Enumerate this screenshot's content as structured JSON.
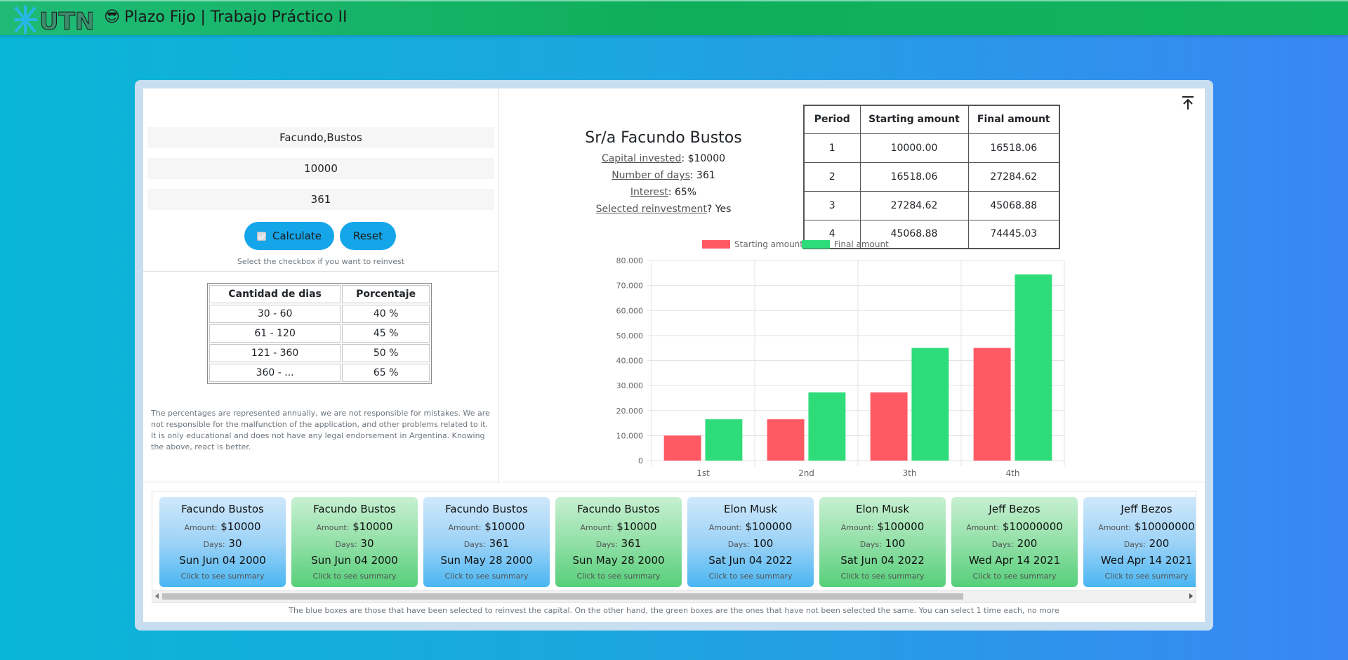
{
  "navbar": {
    "logo_text": "UTN",
    "title": "Plazo Fijo | Trabajo Práctico II",
    "title_emoji": "😎",
    "bg_color": "#12b35e"
  },
  "form": {
    "name_value": "Facundo,Bustos",
    "amount_value": "10000",
    "days_value": "361",
    "calculate_label": "Calculate",
    "reset_label": "Reset",
    "reinvest_checked": true,
    "hint": "Select the checkbox if you want to reinvest",
    "button_color": "#15a6ea"
  },
  "rates": {
    "headers": [
      "Cantidad de dias",
      "Porcentaje"
    ],
    "rows": [
      [
        "30 - 60",
        "40 %"
      ],
      [
        "61 - 120",
        "45 %"
      ],
      [
        "121 - 360",
        "50 %"
      ],
      [
        "360 - ...",
        "65 %"
      ]
    ]
  },
  "disclaimer": "The percentages are represented annually, we are not responsible for mistakes. We are not responsible for the malfunction of the application, and other problems related to it. It is only educational and does not have any legal endorsement in Argentina. Knowing the above, react is better.",
  "summary": {
    "title": "Sr/a Facundo Bustos",
    "capital_label": "Capital invested",
    "capital_value": ": $10000",
    "days_label": "Number of days",
    "days_value": ": 361",
    "interest_label": "Interest",
    "interest_value": ": 65%",
    "reinvest_label": "Selected reinvestment",
    "reinvest_value": "? Yes"
  },
  "periods": {
    "headers": [
      "Period",
      "Starting amount",
      "Final amount"
    ],
    "rows": [
      [
        "1",
        "10000.00",
        "16518.06"
      ],
      [
        "2",
        "16518.06",
        "27284.62"
      ],
      [
        "3",
        "27284.62",
        "45068.88"
      ],
      [
        "4",
        "45068.88",
        "74445.03"
      ]
    ]
  },
  "chart_data": {
    "type": "bar",
    "categories": [
      "1st",
      "2nd",
      "3th",
      "4th"
    ],
    "series": [
      {
        "name": "Starting amount",
        "values": [
          10000.0,
          16518.06,
          27284.62,
          45068.88
        ],
        "color": "#ff5a64"
      },
      {
        "name": "Final amount",
        "values": [
          16518.06,
          27284.62,
          45068.88,
          74445.03
        ],
        "color": "#2fdc7a"
      }
    ],
    "ylim": [
      0,
      80000
    ],
    "yticks": [
      0,
      10000,
      20000,
      30000,
      40000,
      50000,
      60000,
      70000,
      80000
    ],
    "ytick_labels": [
      "0",
      "10.000",
      "20.000",
      "30.000",
      "40.000",
      "50.000",
      "60.000",
      "70.000",
      "80.000"
    ],
    "grid": true,
    "legend": "top",
    "title": "",
    "xlabel": "",
    "ylabel": ""
  },
  "history": {
    "amount_label": "Amount:",
    "days_label": "Days:",
    "click_hint": "Click to see summary",
    "items": [
      {
        "name": "Facundo Bustos",
        "amount": "$10000",
        "days": "30",
        "date": "Sun Jun 04 2000",
        "color": "blue"
      },
      {
        "name": "Facundo Bustos",
        "amount": "$10000",
        "days": "30",
        "date": "Sun Jun 04 2000",
        "color": "green"
      },
      {
        "name": "Facundo Bustos",
        "amount": "$10000",
        "days": "361",
        "date": "Sun May 28 2000",
        "color": "blue"
      },
      {
        "name": "Facundo Bustos",
        "amount": "$10000",
        "days": "361",
        "date": "Sun May 28 2000",
        "color": "green"
      },
      {
        "name": "Elon Musk",
        "amount": "$100000",
        "days": "100",
        "date": "Sat Jun 04 2022",
        "color": "blue"
      },
      {
        "name": "Elon Musk",
        "amount": "$100000",
        "days": "100",
        "date": "Sat Jun 04 2022",
        "color": "green"
      },
      {
        "name": "Jeff Bezos",
        "amount": "$10000000",
        "days": "200",
        "date": "Wed Apr 14 2021",
        "color": "green"
      },
      {
        "name": "Jeff Bezos",
        "amount": "$10000000",
        "days": "200",
        "date": "Wed Apr 14 2021",
        "color": "blue"
      }
    ],
    "footer_note": "The blue boxes are those that have been selected to reinvest the capital. On the other hand, the green boxes are the ones that have not been selected the same. You can select 1 time each, no more"
  }
}
